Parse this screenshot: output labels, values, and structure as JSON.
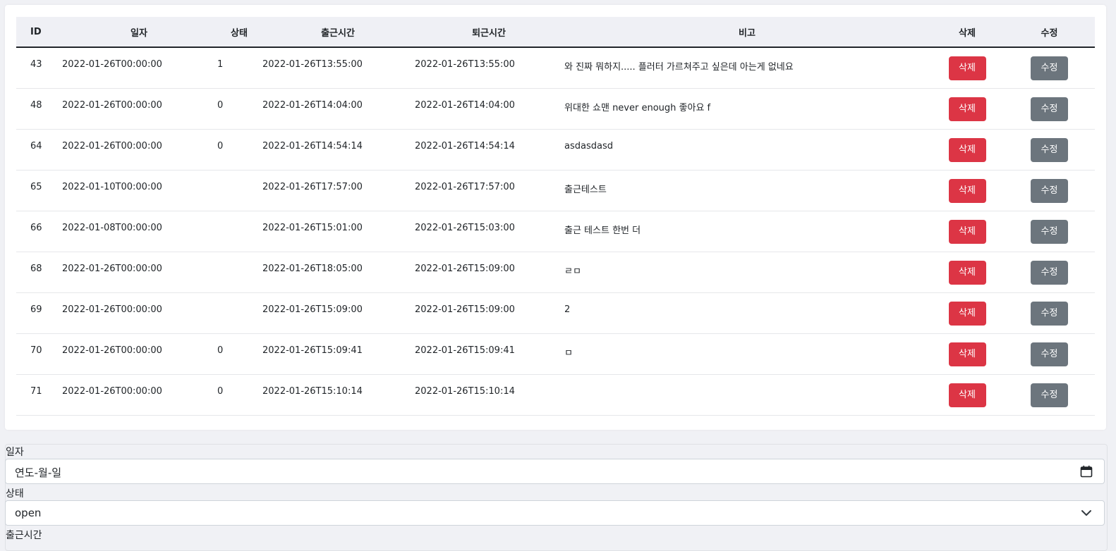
{
  "table": {
    "headers": {
      "id": "ID",
      "date": "일자",
      "status": "상태",
      "checkin": "출근시간",
      "checkout": "퇴근시간",
      "note": "비고",
      "delete": "삭제",
      "edit": "수정"
    },
    "rows": [
      {
        "id": "43",
        "date": "2022-01-26T00:00:00",
        "status": "1",
        "checkin": "2022-01-26T13:55:00",
        "checkout": "2022-01-26T13:55:00",
        "note": "와 진짜 뭐하지..... 플러터 가르쳐주고 싶은데 아는게 없네요",
        "delete_label": "삭제",
        "edit_label": "수정"
      },
      {
        "id": "48",
        "date": "2022-01-26T00:00:00",
        "status": "0",
        "checkin": "2022-01-26T14:04:00",
        "checkout": "2022-01-26T14:04:00",
        "note": "위대한 쇼맨 never enough 좋아요 f",
        "delete_label": "삭제",
        "edit_label": "수정"
      },
      {
        "id": "64",
        "date": "2022-01-26T00:00:00",
        "status": "0",
        "checkin": "2022-01-26T14:54:14",
        "checkout": "2022-01-26T14:54:14",
        "note": "asdasdasd",
        "delete_label": "삭제",
        "edit_label": "수정"
      },
      {
        "id": "65",
        "date": "2022-01-10T00:00:00",
        "status": "",
        "checkin": "2022-01-26T17:57:00",
        "checkout": "2022-01-26T17:57:00",
        "note": "출근테스트",
        "delete_label": "삭제",
        "edit_label": "수정"
      },
      {
        "id": "66",
        "date": "2022-01-08T00:00:00",
        "status": "",
        "checkin": "2022-01-26T15:01:00",
        "checkout": "2022-01-26T15:03:00",
        "note": "출근 테스트 한번 더",
        "delete_label": "삭제",
        "edit_label": "수정"
      },
      {
        "id": "68",
        "date": "2022-01-26T00:00:00",
        "status": "",
        "checkin": "2022-01-26T18:05:00",
        "checkout": "2022-01-26T15:09:00",
        "note": "ㄹㅁ",
        "delete_label": "삭제",
        "edit_label": "수정"
      },
      {
        "id": "69",
        "date": "2022-01-26T00:00:00",
        "status": "",
        "checkin": "2022-01-26T15:09:00",
        "checkout": "2022-01-26T15:09:00",
        "note": "2",
        "delete_label": "삭제",
        "edit_label": "수정"
      },
      {
        "id": "70",
        "date": "2022-01-26T00:00:00",
        "status": "0",
        "checkin": "2022-01-26T15:09:41",
        "checkout": "2022-01-26T15:09:41",
        "note": "ㅁ",
        "delete_label": "삭제",
        "edit_label": "수정"
      },
      {
        "id": "71",
        "date": "2022-01-26T00:00:00",
        "status": "0",
        "checkin": "2022-01-26T15:10:14",
        "checkout": "2022-01-26T15:10:14",
        "note": "",
        "delete_label": "삭제",
        "edit_label": "수정"
      }
    ]
  },
  "form": {
    "date_label": "일자",
    "date_placeholder": "연도-월-일",
    "status_label": "상태",
    "status_value": "open",
    "checkin_label": "출근시간"
  },
  "colors": {
    "delete_button": "#dc3545",
    "edit_button": "#6c757d",
    "header_background": "#eff0f5",
    "page_background": "#f0f1f5"
  },
  "icons": {
    "date_field": "calendar-icon",
    "status_field": "chevron-down-icon"
  }
}
